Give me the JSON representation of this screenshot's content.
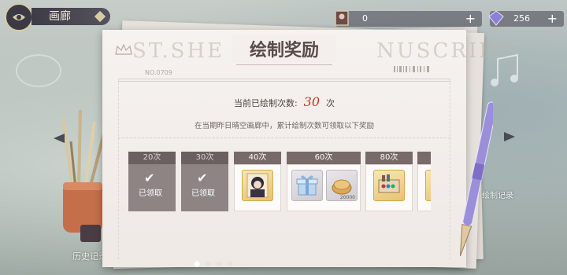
{
  "topbar": {
    "section_title": "画廊",
    "resources": [
      {
        "icon": "portrait-frame-icon",
        "value": "0"
      },
      {
        "icon": "gem-icon",
        "value": "256"
      }
    ],
    "plus_label": "+"
  },
  "panel": {
    "watermark": "ST.SHE",
    "watermark_right": "NUSCRIPT",
    "serial": "NO.0709",
    "title": "绘制奖励",
    "count_prefix": "当前已绘制次数:",
    "count_value": "30",
    "count_suffix": "次",
    "description": "在当期昨日晴空画廊中，累计绘制次数可领取以下奖励"
  },
  "rewards": [
    {
      "label": "20次",
      "state": "claimed",
      "status_text": "已领取"
    },
    {
      "label": "30次",
      "state": "claimed",
      "status_text": "已领取"
    },
    {
      "label": "40次",
      "state": "open",
      "items": [
        {
          "icon": "character-portrait-icon"
        }
      ]
    },
    {
      "label": "60次",
      "state": "open",
      "items": [
        {
          "icon": "gift-box-icon"
        },
        {
          "icon": "coin-pile-icon",
          "qty": "20000"
        }
      ]
    },
    {
      "label": "80次",
      "state": "open",
      "items": [
        {
          "icon": "paint-palette-icon"
        }
      ]
    }
  ],
  "pagination": {
    "pages": 4,
    "active": 0
  },
  "left_label": "历史记录",
  "right_tag": "绘制记录",
  "colors": {
    "accent_red": "#c0392b",
    "card_header": "#776a68",
    "claimed_bg": "#8d8483"
  }
}
